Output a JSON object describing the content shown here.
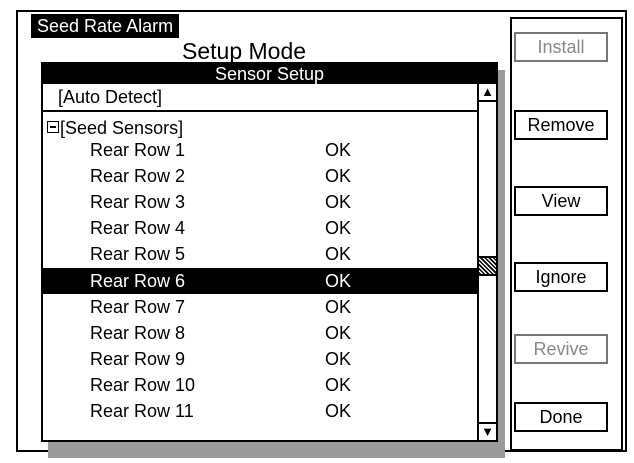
{
  "app": {
    "title": "Seed Rate Alarm",
    "mode_title": "Setup Mode"
  },
  "dialog": {
    "title": "Sensor Setup",
    "auto_detect": "[Auto Detect]",
    "group_label": "[Seed Sensors]",
    "sensors": [
      {
        "name": "Rear Row 1",
        "status": "OK"
      },
      {
        "name": "Rear Row 2",
        "status": "OK"
      },
      {
        "name": "Rear Row 3",
        "status": "OK"
      },
      {
        "name": "Rear Row 4",
        "status": "OK"
      },
      {
        "name": "Rear Row 5",
        "status": "OK"
      },
      {
        "name": "Rear Row 6",
        "status": "OK"
      },
      {
        "name": "Rear Row 7",
        "status": "OK"
      },
      {
        "name": "Rear Row 8",
        "status": "OK"
      },
      {
        "name": "Rear Row 9",
        "status": "OK"
      },
      {
        "name": "Rear Row 10",
        "status": "OK"
      },
      {
        "name": "Rear Row 11",
        "status": "OK"
      }
    ],
    "selected_sensor": "Rear Row 6",
    "scroll": {
      "up_icon": "arrow-up-icon",
      "down_icon": "arrow-down-icon"
    }
  },
  "buttons": {
    "install": "Install",
    "remove": "Remove",
    "view": "View",
    "ignore": "Ignore",
    "revive": "Revive",
    "done": "Done"
  },
  "colors": {
    "selection_background": "#000000",
    "selection_text": "#ffffff",
    "disabled_text": "#888888",
    "shadow": "#9a9a9a"
  }
}
